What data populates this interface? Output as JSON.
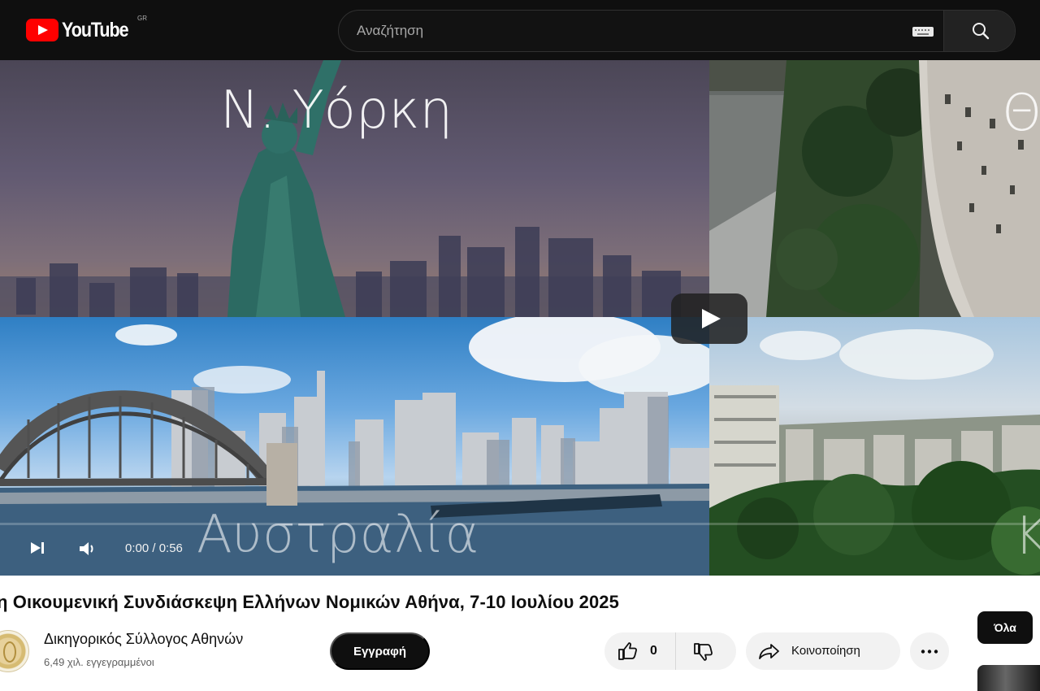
{
  "header": {
    "logo_text": "YouTube",
    "country_code": "GR",
    "search_placeholder": "Αναζήτηση"
  },
  "player": {
    "places": [
      "Ν. Υόρκη",
      "Αυστραλία",
      "Θ",
      "Κ"
    ],
    "time_display": "0:00 / 0:56"
  },
  "video": {
    "title": "η Οικουμενική Συνδιάσκεψη Ελλήνων Νομικών Αθήνα, 7-10 Ιουλίου 2025"
  },
  "channel": {
    "name": "Δικηγορικός Σύλλογος Αθηνών",
    "subscribers": "6,49 χιλ. εγγεγραμμένοι"
  },
  "actions": {
    "subscribe_label": "Εγγραφή",
    "like_count": "0",
    "share_label": "Κοινοποίηση"
  },
  "sidebar": {
    "filter_label": "Όλα"
  },
  "colors": {
    "youtube_red": "#ff0000",
    "header_background": "#0f0f0f",
    "button_background": "#f2f2f2",
    "subscribe_background": "#0f0f0f"
  },
  "icons": {
    "logo": "youtube-logo-icon",
    "keyboard": "keyboard-icon",
    "search": "search-icon",
    "play": "play-icon",
    "next": "next-icon",
    "volume": "volume-icon",
    "like": "thumbs-up-icon",
    "dislike": "thumbs-down-icon",
    "share": "share-icon",
    "more": "more-horizontal-icon"
  }
}
